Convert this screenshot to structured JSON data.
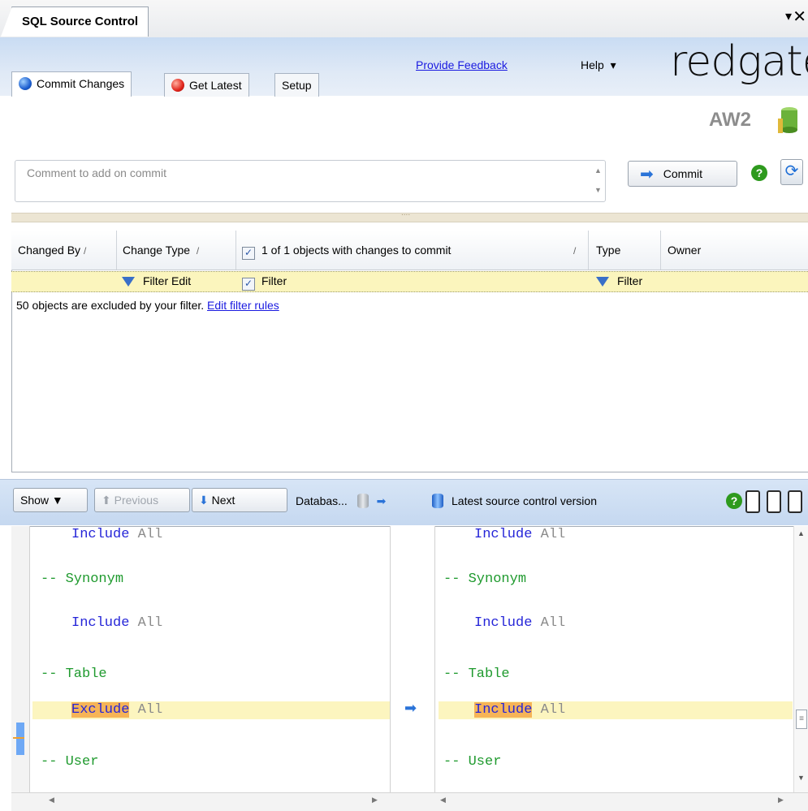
{
  "window": {
    "title": "SQL Source Control",
    "pin_glyph": "▾",
    "close_glyph": "✕"
  },
  "tabs": [
    {
      "label": "Commit Changes",
      "icon": "blue-circle-icon",
      "active": true
    },
    {
      "label": "Get Latest",
      "icon": "red-circle-icon",
      "active": false
    },
    {
      "label": "Setup",
      "active": false
    }
  ],
  "header": {
    "feedback": "Provide Feedback",
    "help": "Help",
    "help_arrow": "▾",
    "logo": "redgate"
  },
  "database": {
    "name": "AW2"
  },
  "commit": {
    "placeholder": "Comment to add on commit",
    "button": "Commit"
  },
  "grid": {
    "columns": [
      "Changed By",
      "Change Type",
      "1 of 1 objects with changes to commit",
      "Type",
      "Owner"
    ],
    "filter_edit": "Filter Edit",
    "filter_label": "Filter",
    "type_filter": "Filter",
    "excluded_text": "50 objects are excluded by your filter.",
    "edit_rules": "Edit filter rules"
  },
  "diff_toolbar": {
    "show": "Show",
    "previous": "Previous",
    "next": "Next",
    "db_name": "Databas...",
    "source": "Latest source control version"
  },
  "diff": {
    "left": [
      {
        "type": "include",
        "kw": "Include",
        "arg": "All"
      },
      {
        "type": "comment",
        "text": "-- Synonym"
      },
      {
        "type": "include",
        "kw": "Include",
        "arg": "All"
      },
      {
        "type": "comment",
        "text": "-- Table"
      },
      {
        "type": "changed",
        "kw": "Exclude",
        "arg": "All"
      },
      {
        "type": "comment",
        "text": "-- User"
      }
    ],
    "right": [
      {
        "type": "include",
        "kw": "Include",
        "arg": "All"
      },
      {
        "type": "comment",
        "text": "-- Synonym"
      },
      {
        "type": "include",
        "kw": "Include",
        "arg": "All"
      },
      {
        "type": "comment",
        "text": "-- Table"
      },
      {
        "type": "changed",
        "kw": "Include",
        "arg": "All"
      },
      {
        "type": "comment",
        "text": "-- User"
      }
    ]
  },
  "colors": {
    "accent": "#2a73d8",
    "highlight": "#fcf5bf",
    "changed": "#f6b457",
    "comment": "#1f9a2e",
    "keyword": "#2525d8"
  }
}
